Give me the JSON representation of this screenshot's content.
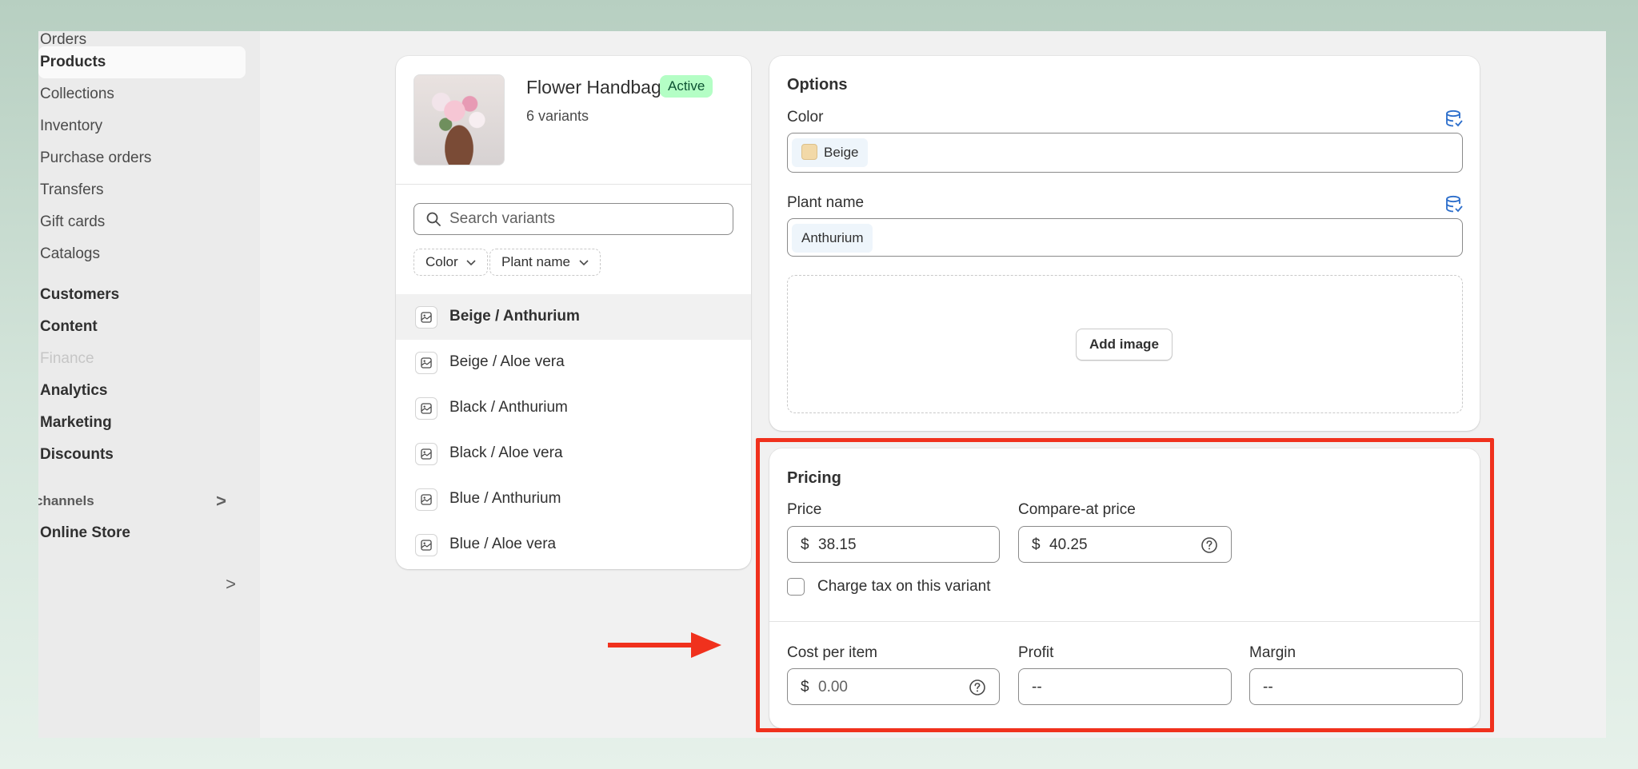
{
  "sidebar": {
    "items": [
      {
        "label": "Orders"
      },
      {
        "label": "Products"
      },
      {
        "label": "Collections"
      },
      {
        "label": "Inventory"
      },
      {
        "label": "Purchase orders"
      },
      {
        "label": "Transfers"
      },
      {
        "label": "Gift cards"
      },
      {
        "label": "Catalogs"
      },
      {
        "label": "Customers"
      },
      {
        "label": "Content"
      },
      {
        "label": "Finance"
      },
      {
        "label": "Analytics"
      },
      {
        "label": "Marketing"
      },
      {
        "label": "Discounts"
      },
      {
        "label": "channels"
      },
      {
        "label": "Online Store"
      }
    ],
    "chevron": ">"
  },
  "product": {
    "title": "Flower Handbag",
    "status": "Active",
    "variants_count": "6 variants"
  },
  "variants": {
    "search_placeholder": "Search variants",
    "filters": [
      {
        "label": "Color"
      },
      {
        "label": "Plant name"
      }
    ],
    "list": [
      {
        "label": "Beige / Anthurium"
      },
      {
        "label": "Beige / Aloe vera"
      },
      {
        "label": "Black / Anthurium"
      },
      {
        "label": "Black / Aloe vera"
      },
      {
        "label": "Blue / Anthurium"
      },
      {
        "label": "Blue / Aloe vera"
      }
    ]
  },
  "options": {
    "title": "Options",
    "color_label": "Color",
    "color_value": "Beige",
    "plant_label": "Plant name",
    "plant_value": "Anthurium",
    "add_image_label": "Add image"
  },
  "pricing": {
    "title": "Pricing",
    "price_label": "Price",
    "price_value": "38.15",
    "compare_label": "Compare-at price",
    "compare_value": "40.25",
    "currency": "$",
    "charge_tax_label": "Charge tax on this variant",
    "cost_label": "Cost per item",
    "cost_value": "0.00",
    "profit_label": "Profit",
    "profit_value": "--",
    "margin_label": "Margin",
    "margin_value": "--"
  },
  "colors": {
    "annotation": "#f0311d",
    "active_badge_bg": "#b4fec5",
    "active_badge_text": "#0c5132",
    "db_icon": "#2c6ecb"
  },
  "icons": [
    "search-icon",
    "chevron-down-icon",
    "image-icon",
    "database-icon",
    "help-circle-icon",
    "chevron-right-icon",
    "arrow-right-icon"
  ]
}
